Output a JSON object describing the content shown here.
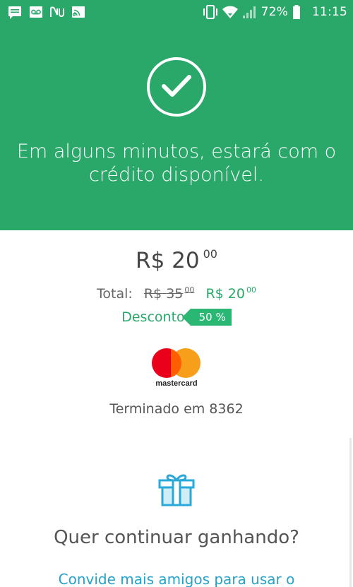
{
  "status_bar": {
    "battery": "72%",
    "time": "11:15",
    "left_icons": [
      "message-icon",
      "voicemail-icon",
      "nubank-icon",
      "cast-icon"
    ],
    "right_icons": [
      "vibrate-icon",
      "wifi-icon",
      "signal-icon",
      "battery-icon"
    ]
  },
  "hero": {
    "message": "Em alguns minutos, estará com o crédito disponível.",
    "icon": "check-circle-icon"
  },
  "amount": {
    "currency": "R$",
    "integer": "20",
    "cents": "00"
  },
  "total": {
    "label": "Total:",
    "old_currency": "R$",
    "old_integer": "35",
    "old_cents": "00",
    "new_currency": "R$",
    "new_integer": "20",
    "new_cents": "00"
  },
  "discount": {
    "label": "Desconto",
    "badge": "50 %"
  },
  "card": {
    "brand": "mastercard",
    "ending": "Terminado em 8362"
  },
  "promo": {
    "icon": "gift-icon",
    "question": "Quer continuar ganhando?",
    "invite_link": "Convide mais amigos para usar o"
  },
  "colors": {
    "brand_green": "#2aa86a",
    "link_blue": "#25a2c9"
  }
}
